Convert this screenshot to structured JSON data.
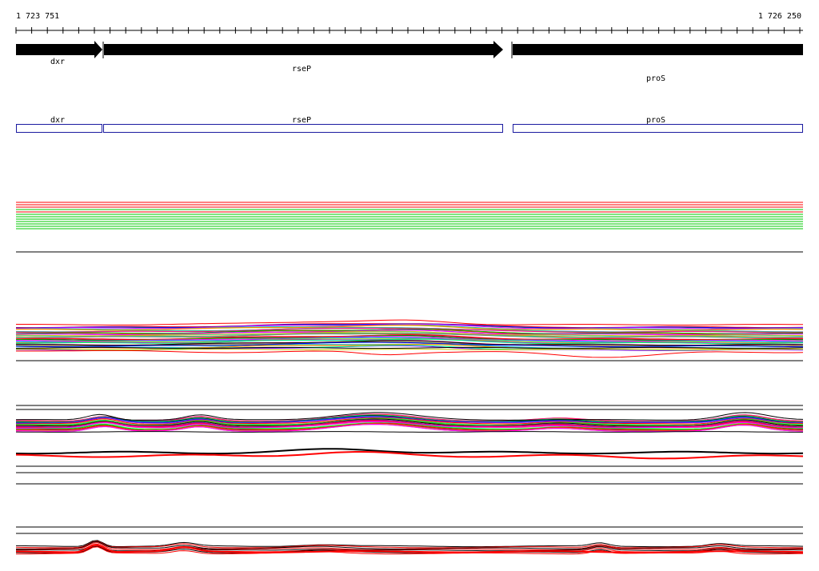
{
  "ruler": {
    "start_label": "1 723 751",
    "end_label": "1 726 250"
  },
  "genes": [
    {
      "name": "dxr"
    },
    {
      "name": "rseP"
    },
    {
      "name": "proS"
    }
  ],
  "colors": {
    "arrow": "#000000",
    "box_outline": "#1a1aa0",
    "divider": "#000000",
    "track_palette": [
      "#ff0000",
      "#00c800",
      "#0000ff",
      "#ff00ff",
      "#00c8c8",
      "#c8c800",
      "#ff8000",
      "#8000ff",
      "#00ff80",
      "#808080",
      "#ff0080",
      "#000000"
    ]
  }
}
